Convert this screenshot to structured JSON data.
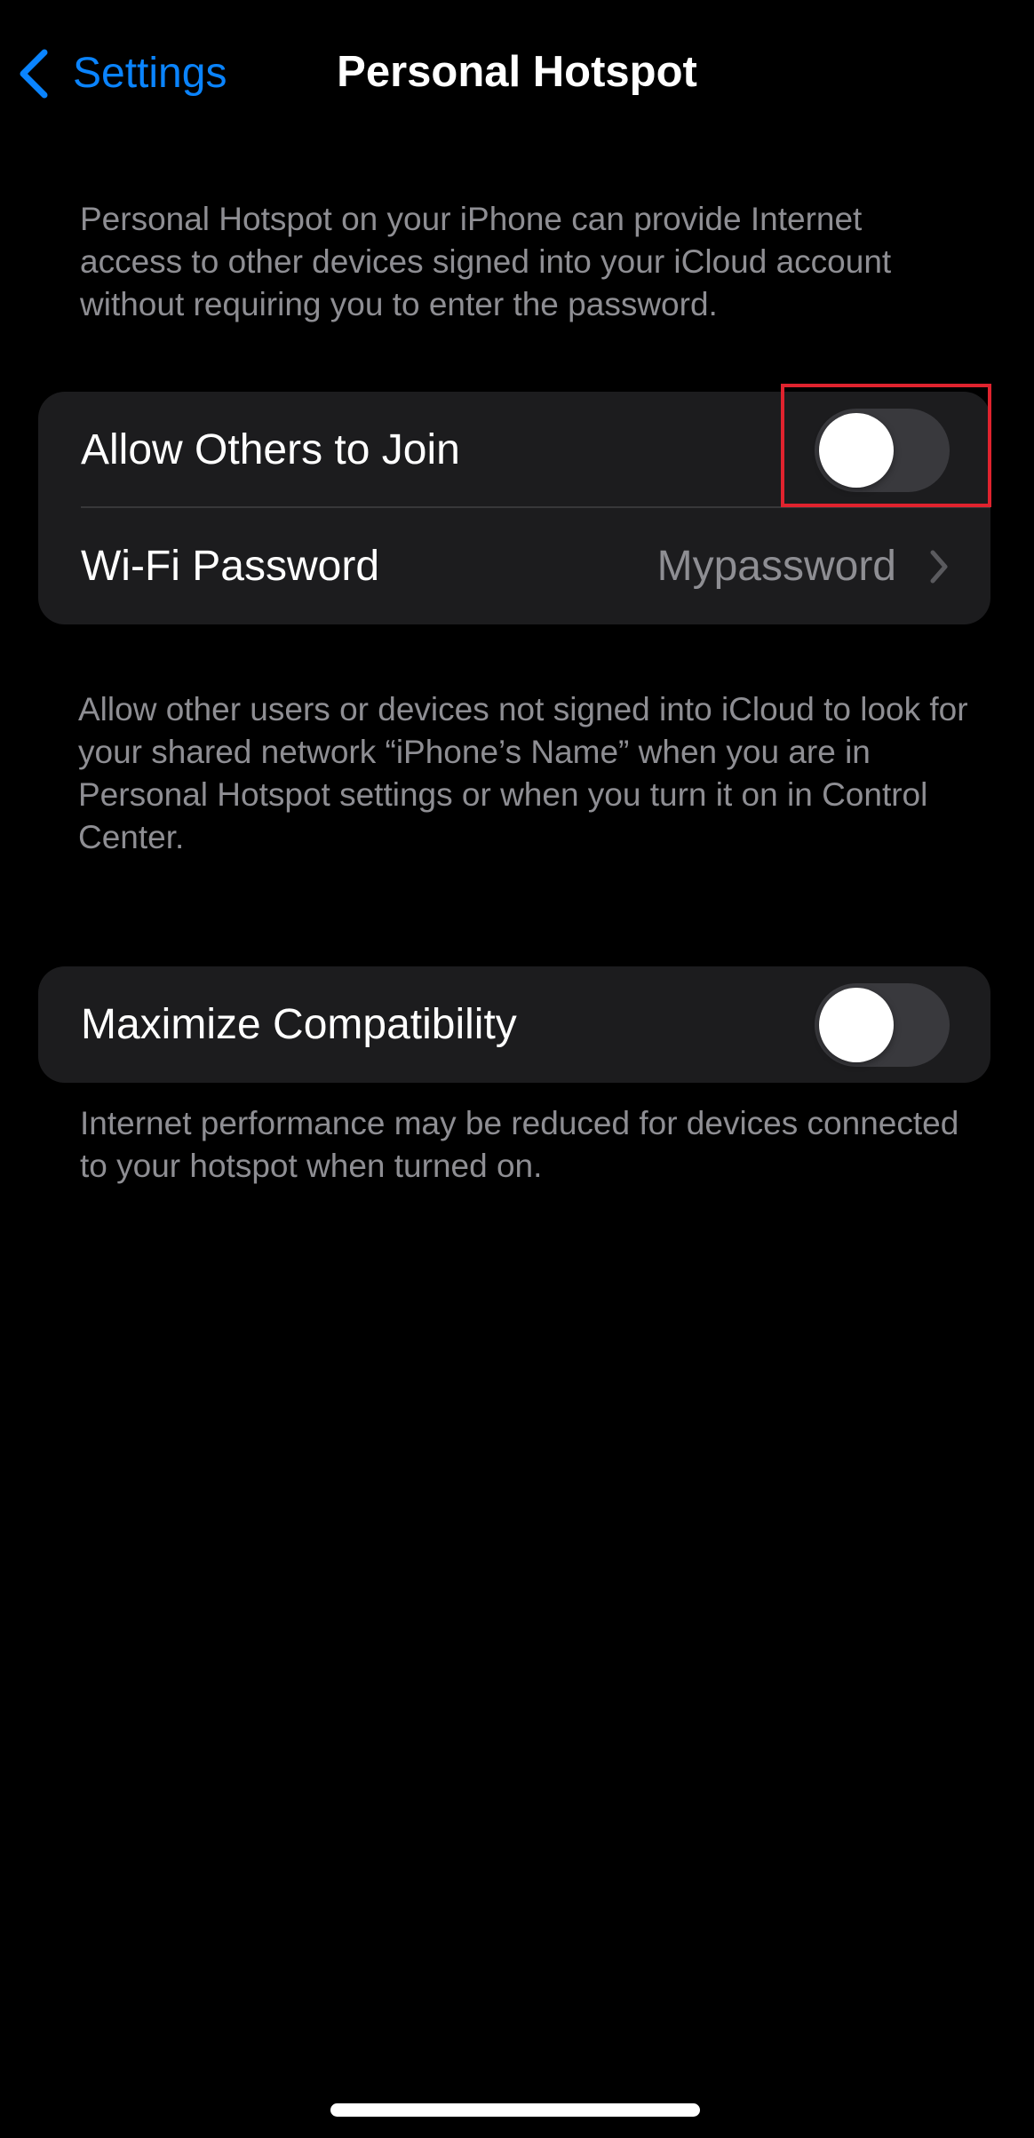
{
  "nav": {
    "back_label": "Settings",
    "title": "Personal Hotspot"
  },
  "intro_footnote": "Personal Hotspot on your iPhone can provide Internet access to other devices signed into your iCloud account without requiring you to enter the password.",
  "group1": {
    "allow_others": {
      "label": "Allow Others to Join",
      "enabled": false
    },
    "wifi_password": {
      "label": "Wi-Fi Password",
      "value": "Mypassword"
    }
  },
  "group1_footnote": "Allow other users or devices not signed into iCloud to look for your shared network “iPhone’s Name” when you are in Personal Hotspot settings or when you turn it on in Control Center.",
  "group2": {
    "maximize_compat": {
      "label": "Maximize Compatibility",
      "enabled": false
    }
  },
  "group2_footnote": "Internet performance may be reduced for devices connected to your hotspot when turned on.",
  "colors": {
    "background": "#000000",
    "group_background": "#1c1c1e",
    "accent_blue": "#0a84ff",
    "secondary_text": "#8e8e93",
    "toggle_off_track": "#39393d",
    "highlight_red": "#e0232e"
  },
  "icons": {
    "back": "chevron-left-icon",
    "disclosure": "chevron-right-icon"
  }
}
